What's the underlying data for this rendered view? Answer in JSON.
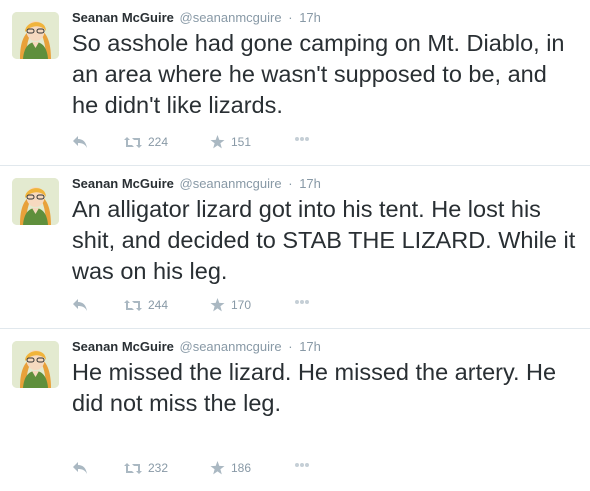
{
  "colors": {
    "text": "#292f33",
    "meta": "#8899a6",
    "icon": "#aab8c2",
    "divider": "#e1e8ed"
  },
  "tweets": [
    {
      "author": {
        "name": "Seanan McGuire",
        "handle": "@seananmcguire"
      },
      "separator": "·",
      "time": "17h",
      "text": "So asshole had gone camping on Mt. Diablo, in an area where he wasn't supposed to be, and he didn't like lizards.",
      "retweets": "224",
      "favorites": "151"
    },
    {
      "author": {
        "name": "Seanan McGuire",
        "handle": "@seananmcguire"
      },
      "separator": "·",
      "time": "17h",
      "text": "An alligator lizard got into his tent. He lost his shit, and decided to STAB THE LIZARD. While it was on his leg.",
      "retweets": "244",
      "favorites": "170"
    },
    {
      "author": {
        "name": "Seanan McGuire",
        "handle": "@seananmcguire"
      },
      "separator": "·",
      "time": "17h",
      "text": "He missed the lizard. He missed the artery. He did not miss the leg.",
      "retweets": "232",
      "favorites": "186"
    }
  ],
  "icons": {
    "reply": "reply-icon",
    "retweet": "retweet-icon",
    "favorite": "star-icon",
    "more": "more-dots-icon",
    "avatar": "avatar-image"
  }
}
